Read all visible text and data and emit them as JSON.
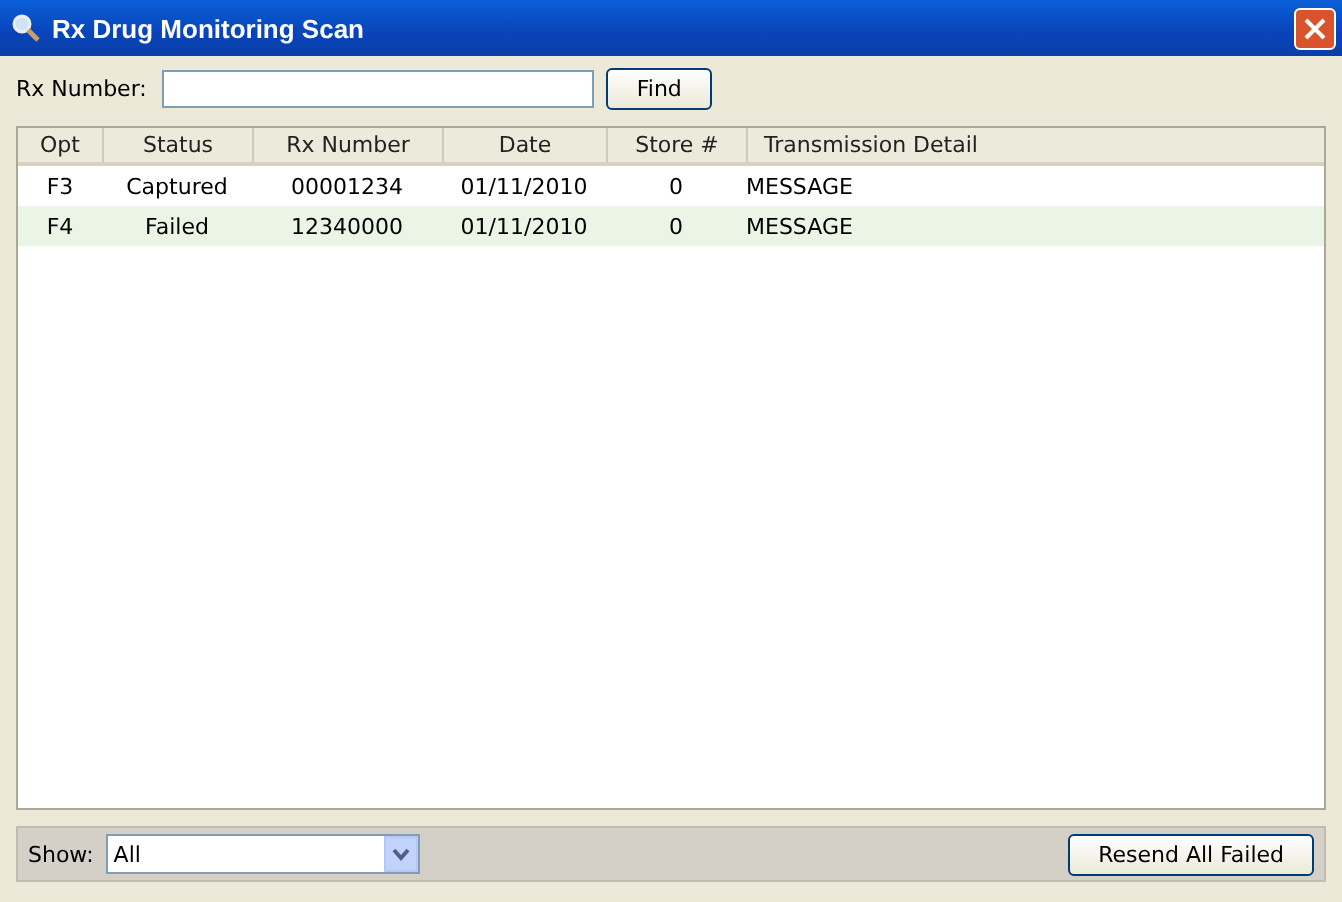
{
  "window": {
    "title": "Rx Drug Monitoring Scan"
  },
  "search": {
    "label": "Rx Number:",
    "button": "Find"
  },
  "table": {
    "columns": [
      "Opt",
      "Status",
      "Rx Number",
      "Date",
      "Store #",
      "Transmission Detail"
    ],
    "rows": [
      [
        "F3",
        "Captured",
        "00001234",
        "01/11/2010",
        "0",
        "MESSAGE"
      ],
      [
        "F4",
        "Failed",
        "12340000",
        "01/11/2010",
        "0",
        "MESSAGE"
      ]
    ]
  },
  "footer": {
    "show_label": "Show:",
    "show_value": "All",
    "button": "Resend All Failed"
  }
}
